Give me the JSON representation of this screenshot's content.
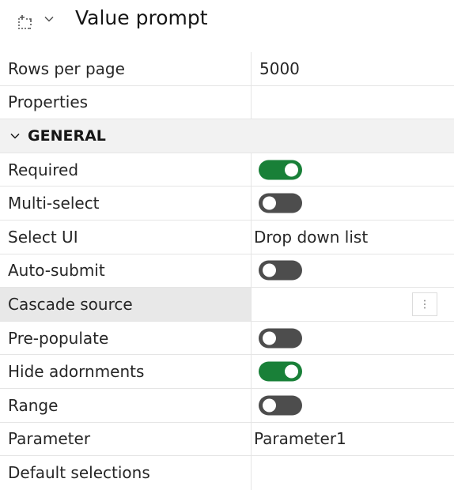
{
  "header": {
    "title": "Value prompt",
    "select_icon": "dashed-selection-icon",
    "dropdown_icon": "chevron-down-icon"
  },
  "properties": {
    "rows_per_page": {
      "label": "Rows per page",
      "value": "5000"
    },
    "properties_row": {
      "label": "Properties",
      "value": ""
    },
    "section_general": {
      "label": "GENERAL",
      "icon": "chevron-down-icon"
    },
    "required": {
      "label": "Required",
      "on": true
    },
    "multi_select": {
      "label": "Multi-select",
      "on": false
    },
    "select_ui": {
      "label": "Select UI",
      "value": "Drop down list"
    },
    "auto_submit": {
      "label": "Auto-submit",
      "on": false
    },
    "cascade_source": {
      "label": "Cascade source",
      "value": "",
      "action_icon": "overflow-menu-vertical-icon"
    },
    "pre_populate": {
      "label": "Pre-populate",
      "on": false
    },
    "hide_adornments": {
      "label": "Hide adornments",
      "on": true
    },
    "range": {
      "label": "Range",
      "on": false
    },
    "parameter": {
      "label": "Parameter",
      "value": "Parameter1"
    },
    "default_selections": {
      "label": "Default selections",
      "value": ""
    }
  },
  "colors": {
    "toggle_on": "#198038",
    "toggle_off": "#4d4d4d",
    "section_bg": "#f2f2f2",
    "highlight_bg": "#e8e8e8"
  }
}
